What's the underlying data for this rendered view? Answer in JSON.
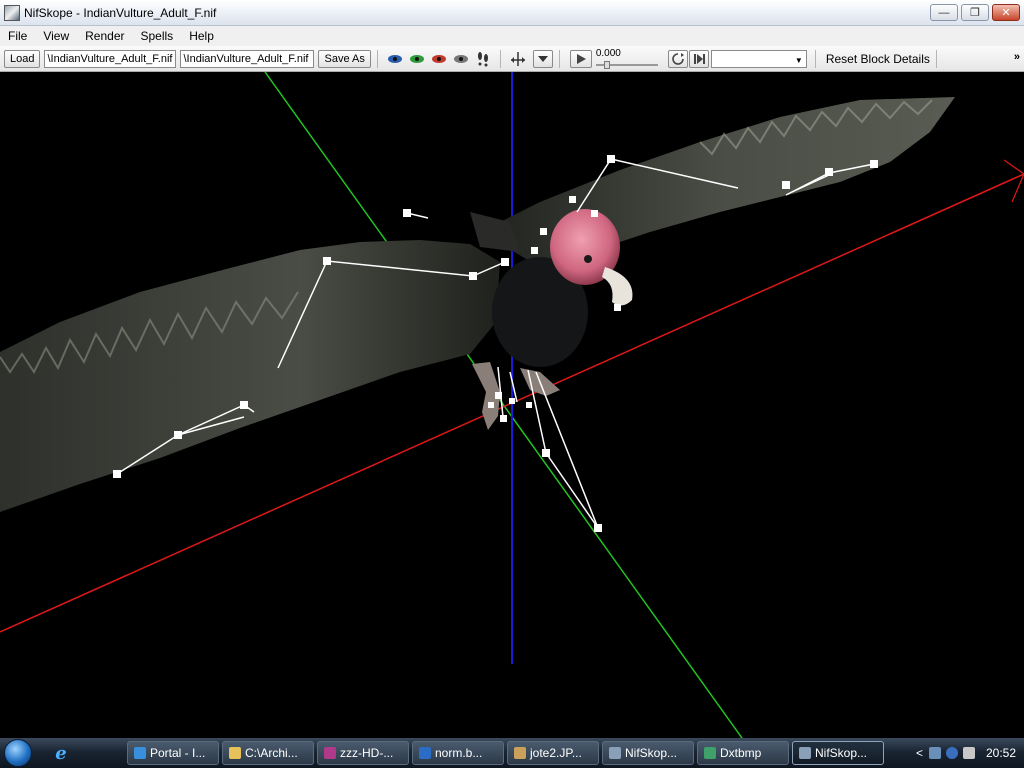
{
  "window": {
    "title": "NifSkope - IndianVulture_Adult_F.nif",
    "controls": {
      "minimize": "—",
      "maximize": "❐",
      "close": "✕"
    }
  },
  "menu": [
    "File",
    "View",
    "Render",
    "Spells",
    "Help"
  ],
  "toolbar": {
    "load_label": "Load",
    "load_path": "\\IndianVulture_Adult_F.nif",
    "save_path": "\\IndianVulture_Adult_F.nif",
    "save_as_label": "Save As",
    "time_value": "0.000",
    "reset_label": "Reset Block Details",
    "more_label": "»",
    "eye_colors": [
      "#2a5db0",
      "#2e9a3c",
      "#c0392b",
      "#666666"
    ]
  },
  "taskbar": {
    "tasks": [
      {
        "label": "Portal - I...",
        "icon": "ie-icon",
        "color": "#3a8fdc"
      },
      {
        "label": "C:\\Archi...",
        "icon": "folder-icon",
        "color": "#e7c25a"
      },
      {
        "label": "zzz-HD-...",
        "icon": "archive-icon",
        "color": "#b03a8a"
      },
      {
        "label": "norm.b...",
        "icon": "photoshop-icon",
        "color": "#2b6cc4"
      },
      {
        "label": "jote2.JP...",
        "icon": "image-icon",
        "color": "#caa05a"
      },
      {
        "label": "NifSkop...",
        "icon": "nifskope-icon",
        "color": "#8aa0b8"
      },
      {
        "label": "Dxtbmp",
        "icon": "dxtbmp-icon",
        "color": "#3fa06a"
      },
      {
        "label": "NifSkop...",
        "icon": "nifskope-icon",
        "color": "#8aa0b8",
        "active": true
      }
    ],
    "tray_expand": "<",
    "clock": "20:52"
  }
}
